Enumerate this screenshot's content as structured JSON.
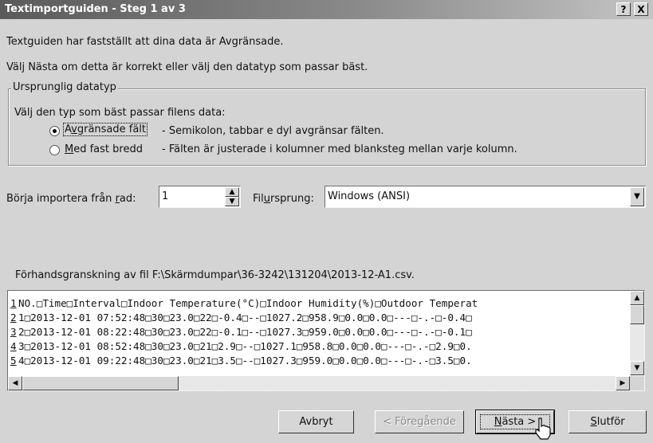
{
  "window": {
    "title": "Textimportguiden - Steg 1 av 3",
    "help_glyph": "?",
    "close_glyph": "X"
  },
  "intro": {
    "line1": "Textguiden har fastställt att dina data är Avgränsade.",
    "line2": "Välj Nästa om detta är korrekt eller välj den datatyp som passar bäst."
  },
  "datatype_group": {
    "legend": "Ursprunglig datatyp",
    "prompt": "Välj den typ som bäst passar filens data:",
    "options": [
      {
        "label_pre": "A",
        "label_key": "v",
        "label_post": "gränsade fält",
        "description": "- Semikolon, tabbar e dyl avgränsar fälten.",
        "selected": true
      },
      {
        "label_pre": "",
        "label_key": "M",
        "label_post": "ed fast bredd",
        "description": "- Fälten är justerade i kolumner med blanksteg mellan varje kolumn.",
        "selected": false
      }
    ]
  },
  "import_row": {
    "label_pre": "Börja importera från ",
    "label_key": "r",
    "label_post": "ad:",
    "value": "1",
    "origin_label_pre": "Fil",
    "origin_label_key": "u",
    "origin_label_post": "rsprung:",
    "origin_value": "Windows (ANSI)"
  },
  "preview": {
    "caption": "Förhandsgranskning av fil F:\\Skärmdumpar\\36-3242\\131204\\2013-12-A1.csv.",
    "rows": [
      {
        "num": "1",
        "text": "NO.□Time□Interval□Indoor Temperature(°C)□Indoor Humidity(%)□Outdoor Temperat"
      },
      {
        "num": "2",
        "text": "1□2013-12-01 07:52:48□30□23.0□22□-0.4□--□1027.2□958.9□0.0□0.0□---□-.-□-0.4□"
      },
      {
        "num": "3",
        "text": "2□2013-12-01 08:22:48□30□23.0□22□-0.1□--□1027.3□959.0□0.0□0.0□---□-.-□-0.1□"
      },
      {
        "num": "4",
        "text": "3□2013-12-01 08:52:48□30□23.0□21□2.9□--□1027.1□958.8□0.0□0.0□---□-.-□2.9□0."
      },
      {
        "num": "5",
        "text": "4□2013-12-01 09:22:48□30□23.0□21□3.5□--□1027.3□959.0□0.0□0.0□---□-.-□3.5□0."
      }
    ]
  },
  "buttons": {
    "cancel": "Avbryt",
    "back": "< Föregående",
    "next_key": "N",
    "next_post": "ästa >",
    "finish_key": "S",
    "finish_post": "lutför"
  }
}
